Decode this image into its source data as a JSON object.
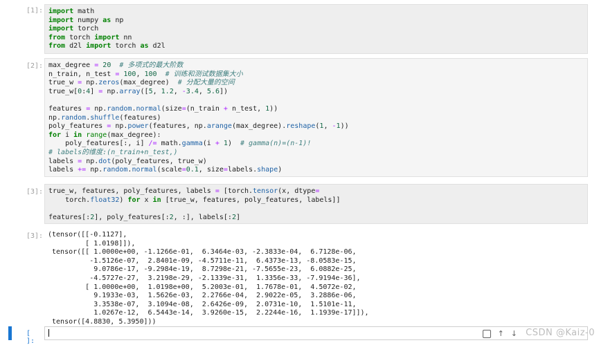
{
  "cells": [
    {
      "prompt": "[1]:",
      "lines": [
        [
          [
            "kw",
            "import"
          ],
          [
            "t",
            " math"
          ]
        ],
        [
          [
            "kw",
            "import"
          ],
          [
            "t",
            " numpy "
          ],
          [
            "kw",
            "as"
          ],
          [
            "t",
            " np"
          ]
        ],
        [
          [
            "kw",
            "import"
          ],
          [
            "t",
            " torch"
          ]
        ],
        [
          [
            "kw",
            "from"
          ],
          [
            "t",
            " torch "
          ],
          [
            "kw",
            "import"
          ],
          [
            "t",
            " nn"
          ]
        ],
        [
          [
            "kw",
            "from"
          ],
          [
            "t",
            " d2l "
          ],
          [
            "kw",
            "import"
          ],
          [
            "t",
            " torch "
          ],
          [
            "kw",
            "as"
          ],
          [
            "t",
            " d2l"
          ]
        ]
      ]
    },
    {
      "prompt": "[2]:",
      "lines": [
        [
          [
            "t",
            "max_degree "
          ],
          [
            "op",
            "="
          ],
          [
            "t",
            " "
          ],
          [
            "num",
            "20"
          ],
          [
            "t",
            "  "
          ],
          [
            "cm",
            "# 多项式的最大阶数"
          ]
        ],
        [
          [
            "t",
            "n_train, n_test "
          ],
          [
            "op",
            "="
          ],
          [
            "t",
            " "
          ],
          [
            "num",
            "100"
          ],
          [
            "t",
            ", "
          ],
          [
            "num",
            "100"
          ],
          [
            "t",
            "  "
          ],
          [
            "cm",
            "# 训练和测试数据集大小"
          ]
        ],
        [
          [
            "t",
            "true_w "
          ],
          [
            "op",
            "="
          ],
          [
            "t",
            " np."
          ],
          [
            "fn",
            "zeros"
          ],
          [
            "t",
            "(max_degree)  "
          ],
          [
            "cm",
            "# 分配大量的空间"
          ]
        ],
        [
          [
            "t",
            "true_w["
          ],
          [
            "num",
            "0"
          ],
          [
            "t",
            ":"
          ],
          [
            "num",
            "4"
          ],
          [
            "t",
            "] "
          ],
          [
            "op",
            "="
          ],
          [
            "t",
            " np."
          ],
          [
            "fn",
            "array"
          ],
          [
            "t",
            "(["
          ],
          [
            "num",
            "5"
          ],
          [
            "t",
            ", "
          ],
          [
            "num",
            "1.2"
          ],
          [
            "t",
            ", "
          ],
          [
            "op",
            "-"
          ],
          [
            "num",
            "3.4"
          ],
          [
            "t",
            ", "
          ],
          [
            "num",
            "5.6"
          ],
          [
            "t",
            "])"
          ]
        ],
        [
          [
            "t",
            ""
          ]
        ],
        [
          [
            "t",
            "features "
          ],
          [
            "op",
            "="
          ],
          [
            "t",
            " np."
          ],
          [
            "fn",
            "random"
          ],
          [
            "t",
            "."
          ],
          [
            "fn",
            "normal"
          ],
          [
            "t",
            "(size"
          ],
          [
            "op",
            "="
          ],
          [
            "t",
            "(n_train "
          ],
          [
            "op",
            "+"
          ],
          [
            "t",
            " n_test, "
          ],
          [
            "num",
            "1"
          ],
          [
            "t",
            "))"
          ]
        ],
        [
          [
            "t",
            "np."
          ],
          [
            "fn",
            "random"
          ],
          [
            "t",
            "."
          ],
          [
            "fn",
            "shuffle"
          ],
          [
            "t",
            "(features)"
          ]
        ],
        [
          [
            "t",
            "poly_features "
          ],
          [
            "op",
            "="
          ],
          [
            "t",
            " np."
          ],
          [
            "fn",
            "power"
          ],
          [
            "t",
            "(features, np."
          ],
          [
            "fn",
            "arange"
          ],
          [
            "t",
            "(max_degree)."
          ],
          [
            "fn",
            "reshape"
          ],
          [
            "t",
            "("
          ],
          [
            "num",
            "1"
          ],
          [
            "t",
            ", "
          ],
          [
            "op",
            "-"
          ],
          [
            "num",
            "1"
          ],
          [
            "t",
            "))"
          ]
        ],
        [
          [
            "kw",
            "for"
          ],
          [
            "t",
            " i "
          ],
          [
            "kw",
            "in"
          ],
          [
            "t",
            " "
          ],
          [
            "bi",
            "range"
          ],
          [
            "t",
            "(max_degree):"
          ]
        ],
        [
          [
            "t",
            "    poly_features[:, i] "
          ],
          [
            "op",
            "/="
          ],
          [
            "t",
            " math."
          ],
          [
            "fn",
            "gamma"
          ],
          [
            "t",
            "(i "
          ],
          [
            "op",
            "+"
          ],
          [
            "t",
            " "
          ],
          [
            "num",
            "1"
          ],
          [
            "t",
            ")  "
          ],
          [
            "cm",
            "# gamma(n)=(n-1)!"
          ]
        ],
        [
          [
            "cm",
            "# labels的维度:(n_train+n_test,)"
          ]
        ],
        [
          [
            "t",
            "labels "
          ],
          [
            "op",
            "="
          ],
          [
            "t",
            " np."
          ],
          [
            "fn",
            "dot"
          ],
          [
            "t",
            "(poly_features, true_w)"
          ]
        ],
        [
          [
            "t",
            "labels "
          ],
          [
            "op",
            "+="
          ],
          [
            "t",
            " np."
          ],
          [
            "fn",
            "random"
          ],
          [
            "t",
            "."
          ],
          [
            "fn",
            "normal"
          ],
          [
            "t",
            "(scale"
          ],
          [
            "op",
            "="
          ],
          [
            "num",
            "0.1"
          ],
          [
            "t",
            ", size"
          ],
          [
            "op",
            "="
          ],
          [
            "t",
            "labels."
          ],
          [
            "fn",
            "shape"
          ],
          [
            "t",
            ")"
          ]
        ]
      ]
    },
    {
      "prompt": "[3]:",
      "lines": [
        [
          [
            "t",
            "true_w, features, poly_features, labels "
          ],
          [
            "op",
            "="
          ],
          [
            "t",
            " [torch."
          ],
          [
            "fn",
            "tensor"
          ],
          [
            "t",
            "(x, dtype"
          ],
          [
            "op",
            "="
          ]
        ],
        [
          [
            "t",
            "    torch."
          ],
          [
            "fn",
            "float32"
          ],
          [
            "t",
            ") "
          ],
          [
            "kw",
            "for"
          ],
          [
            "t",
            " x "
          ],
          [
            "kw",
            "in"
          ],
          [
            "t",
            " [true_w, features, poly_features, labels]]"
          ]
        ],
        [
          [
            "t",
            ""
          ]
        ],
        [
          [
            "t",
            "features[:"
          ],
          [
            "num",
            "2"
          ],
          [
            "t",
            "], poly_features[:"
          ],
          [
            "num",
            "2"
          ],
          [
            "t",
            ", :], labels[:"
          ],
          [
            "num",
            "2"
          ],
          [
            "t",
            "]"
          ]
        ]
      ]
    }
  ],
  "output": {
    "prompt": "[3]:",
    "lines": [
      "(tensor([[-0.1127],",
      "         [ 1.0198]]),",
      " tensor([[ 1.0000e+00, -1.1266e-01,  6.3464e-03, -2.3833e-04,  6.7128e-06,",
      "          -1.5126e-07,  2.8401e-09, -4.5711e-11,  6.4373e-13, -8.0583e-15,",
      "           9.0786e-17, -9.2984e-19,  8.7298e-21, -7.5655e-23,  6.0882e-25,",
      "          -4.5727e-27,  3.2198e-29, -2.1339e-31,  1.3356e-33, -7.9194e-36],",
      "         [ 1.0000e+00,  1.0198e+00,  5.2003e-01,  1.7678e-01,  4.5072e-02,",
      "           9.1933e-03,  1.5626e-03,  2.2766e-04,  2.9022e-05,  3.2886e-06,",
      "           3.3538e-07,  3.1094e-08,  2.6426e-09,  2.0731e-10,  1.5101e-11,",
      "           1.0267e-12,  6.5443e-14,  3.9260e-15,  2.2244e-16,  1.1939e-17]]),",
      " tensor([4.8830, 5.3950]))"
    ]
  },
  "empty_cell": {
    "prompt": "[ ]:"
  },
  "watermark": "CSDN @Kaiz-0"
}
